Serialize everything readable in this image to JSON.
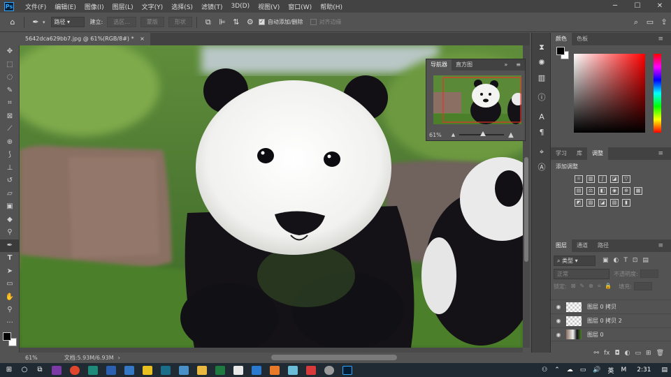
{
  "menubar": {
    "logo": "Ps",
    "items": [
      "文件(F)",
      "编辑(E)",
      "图像(I)",
      "图层(L)",
      "文字(Y)",
      "选择(S)",
      "滤镜(T)",
      "3D(D)",
      "视图(V)",
      "窗口(W)",
      "帮助(H)"
    ]
  },
  "optbar": {
    "mode": "路径",
    "make_label": "建立:",
    "selection_btn": "选区...",
    "mask_btn": "蒙版",
    "shape_btn": "形状",
    "auto_label": "自动添加/删除",
    "align_label": "对齐边缘"
  },
  "doc": {
    "tab_title": "5642dca629bb7.jpg @ 61%(RGB/8#) *",
    "zoom": "61%",
    "doc_info": "文档:5.93M/6.93M"
  },
  "navigator": {
    "tabs": [
      "导航器",
      "直方图"
    ],
    "zoom": "61%"
  },
  "color_panel": {
    "tabs": [
      "颜色",
      "色板"
    ],
    "fg": "#000000",
    "bg": "#ffffff"
  },
  "adjust_panel": {
    "tabs": [
      "学习",
      "库",
      "调整"
    ],
    "title": "添加调整"
  },
  "layers_panel": {
    "tabs": [
      "图层",
      "通道",
      "路径"
    ],
    "filter": "类型",
    "blend": "正常",
    "opacity_label": "不透明度:",
    "lock_label": "锁定:",
    "fill_label": "填充:",
    "layers": [
      {
        "name": "图层 0 拷贝"
      },
      {
        "name": "图层 0 拷贝 2"
      },
      {
        "name": "图层 0"
      }
    ]
  },
  "taskbar": {
    "ime": "英",
    "time": "2:31"
  },
  "colors": {
    "accent": "#31a8ff",
    "panel": "#535353",
    "panel_dark": "#424242"
  }
}
